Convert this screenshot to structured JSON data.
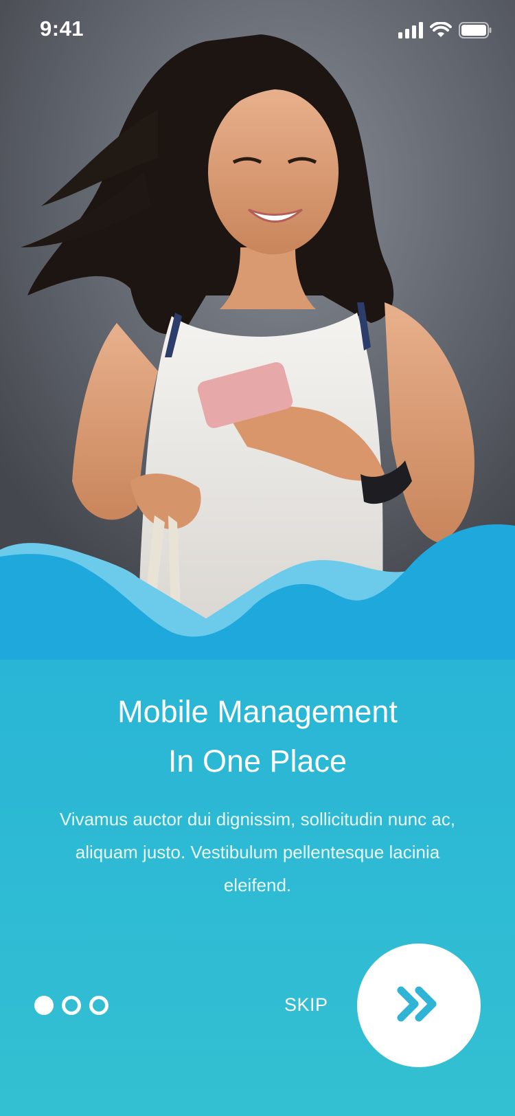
{
  "status_bar": {
    "time": "9:41",
    "icons": [
      "signal-icon",
      "wifi-icon",
      "battery-icon"
    ]
  },
  "hero": {
    "image": "woman-smiling-looking-at-phone"
  },
  "onboarding": {
    "title_line1": "Mobile Management",
    "title_line2": "In One Place",
    "description": "Vivamus auctor dui dignissim, sollicitudin nunc ac, aliquam justo. Vestibulum pellentesque lacinia eleifend.",
    "page_indicator": {
      "total": 3,
      "current": 1
    },
    "skip_label": "SKIP",
    "next_icon": "double-chevron-right-icon"
  },
  "colors": {
    "accent": "#1FA8DC",
    "accent_light": "#6CCBEB",
    "gradient_bottom": "#33C0D2",
    "white": "#FFFFFF"
  }
}
